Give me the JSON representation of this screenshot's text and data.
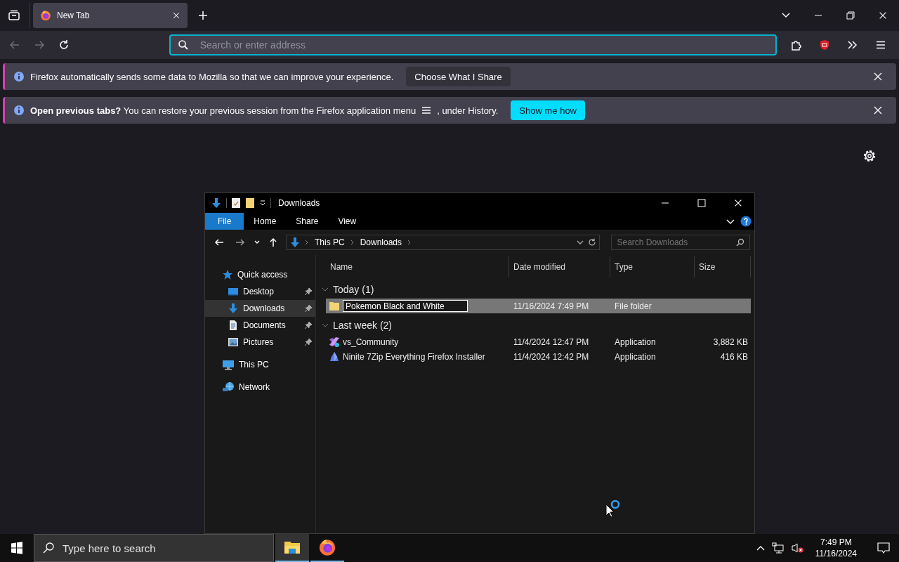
{
  "browser": {
    "tabs": [
      {
        "label": "New Tab",
        "selected": true
      }
    ],
    "urlbar": {
      "placeholder": "Search or enter address"
    },
    "notifications": [
      {
        "kind": "plain",
        "message": "Firefox automatically sends some data to Mozilla so that we can improve your experience.",
        "button": "Choose What I Share"
      },
      {
        "kind": "primary",
        "message": "**Open previous tabs?** You can restore your previous session from the Firefox application menu",
        "message_end": ", under History.",
        "button": "Show me how"
      }
    ]
  },
  "explorer": {
    "title": "Downloads",
    "ribbon_tabs": [
      {
        "label": "File",
        "selected": true
      },
      {
        "label": "Home",
        "selected": false
      },
      {
        "label": "Share",
        "selected": false
      },
      {
        "label": "View",
        "selected": false
      }
    ],
    "breadcrumb": [
      "This PC",
      "Downloads"
    ],
    "search": {
      "placeholder": "Search Downloads"
    },
    "nav": [
      {
        "label": "Quick access",
        "kind": "star",
        "selected": false,
        "pinned": false,
        "children": [
          {
            "label": "Desktop",
            "kind": "desktop",
            "selected": false,
            "pinned": true
          },
          {
            "label": "Downloads",
            "kind": "download",
            "selected": true,
            "pinned": true
          },
          {
            "label": "Documents",
            "kind": "document",
            "selected": false,
            "pinned": true
          },
          {
            "label": "Pictures",
            "kind": "pictures",
            "selected": false,
            "pinned": true
          }
        ]
      },
      {
        "label": "This PC",
        "kind": "pc",
        "selected": false,
        "pinned": false
      },
      {
        "label": "Network",
        "kind": "network",
        "selected": false,
        "pinned": false
      }
    ],
    "columns": [
      "Name",
      "Date modified",
      "Type",
      "Size"
    ],
    "groups": [
      {
        "label": "Today (1)",
        "expanded": true,
        "rows": [
          {
            "kind": "folder",
            "name": "Pokemon Black and White",
            "date": "11/16/2024 7:49 PM",
            "type": "File folder",
            "selected": true,
            "renaming": true
          }
        ]
      },
      {
        "label": "Last week (2)",
        "expanded": true,
        "rows": [
          {
            "kind": "vs",
            "name": "vs_Community",
            "date": "11/4/2024 12:47 PM",
            "type": "Application",
            "size": "3,882 KB",
            "selected": false,
            "renaming": false
          },
          {
            "kind": "ninite",
            "name": "Ninite 7Zip Everything Firefox Installer",
            "date": "11/4/2024 12:42 PM",
            "type": "Application",
            "size": "416 KB",
            "selected": false,
            "renaming": false
          }
        ]
      }
    ]
  },
  "taskbar": {
    "search": {
      "placeholder": "Type here to search"
    },
    "apps": [
      {
        "kind": "explorer",
        "active": true
      },
      {
        "kind": "firefox",
        "active": false
      }
    ],
    "time": "7:49 PM",
    "date": "11/16/2024"
  }
}
